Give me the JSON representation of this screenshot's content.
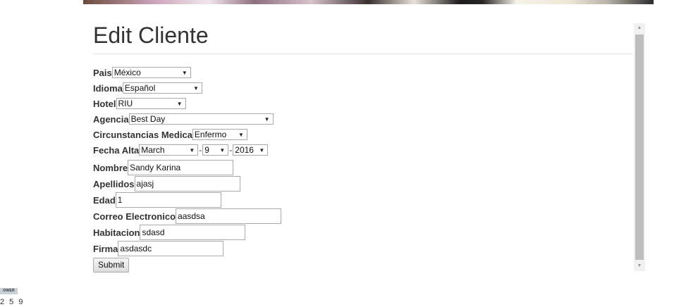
{
  "page": {
    "title": "Edit Cliente"
  },
  "form": {
    "pais": {
      "label": "Pais",
      "value": "México"
    },
    "idioma": {
      "label": "Idioma",
      "value": "Español"
    },
    "hotel": {
      "label": "Hotel",
      "value": "RIU"
    },
    "agencia": {
      "label": "Agencia",
      "value": "Best Day"
    },
    "circunstancias": {
      "label": "Circunstancias Medica",
      "value": "Enfermo"
    },
    "fecha_alta": {
      "label": "Fecha Alta",
      "month": "March",
      "day": "9",
      "year": "2016",
      "separator": "-"
    },
    "nombre": {
      "label": "Nombre",
      "value": "Sandy Karina"
    },
    "apellidos": {
      "label": "Apellidos",
      "value": "ajasj"
    },
    "edad": {
      "label": "Edad",
      "value": "1"
    },
    "correo": {
      "label": "Correo Electronico",
      "value": "aasdsa"
    },
    "habitacion": {
      "label": "Habitacion",
      "value": "sdasd"
    },
    "firma": {
      "label": "Firma",
      "value": "asdasdc"
    },
    "submit_label": "Submit"
  },
  "footer": {
    "badge_text": "OWER",
    "digits": "2 5 9"
  },
  "icons": {
    "scroll_up": "triangle-up-icon",
    "scroll_down": "triangle-down-icon",
    "dropdown": "chevron-down-icon"
  }
}
